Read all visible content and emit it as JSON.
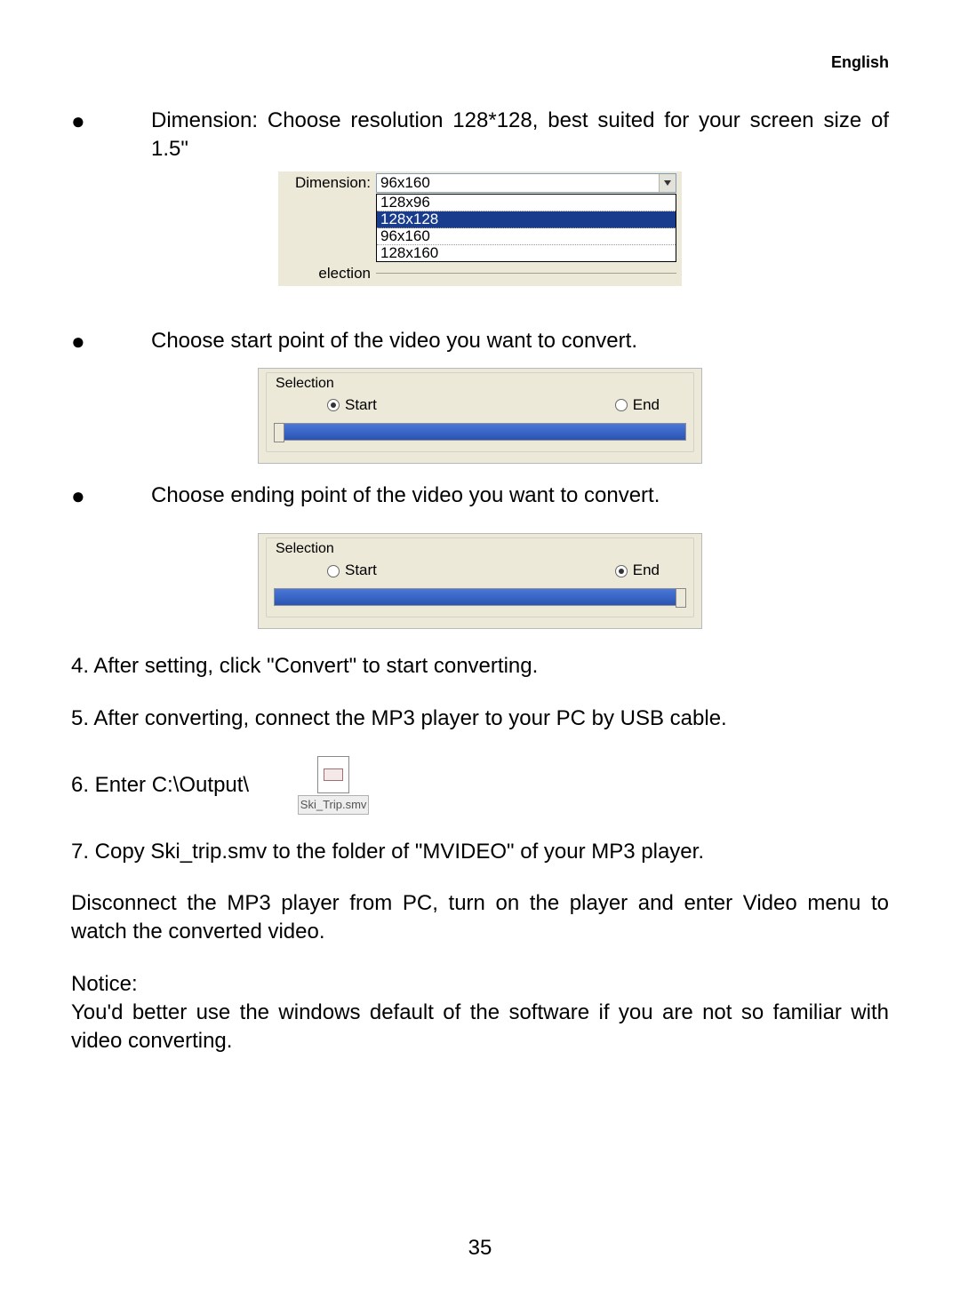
{
  "header": {
    "language": "English"
  },
  "bullets": {
    "b1": "Dimension: Choose resolution 128*128, best suited for your screen size of 1.5\"",
    "b2": "Choose start point of the video you want to convert.",
    "b3": "Choose ending point of the video you want to convert."
  },
  "dimension_ui": {
    "label": "Dimension:",
    "value": "96x160",
    "options": [
      "128x96",
      "128x128",
      "96x160",
      "128x160"
    ],
    "selected_index": 1,
    "bottom_label": "election"
  },
  "selection_ui": {
    "legend": "Selection",
    "start_label": "Start",
    "end_label": "End"
  },
  "steps": {
    "s4": "4. After setting, click \"Convert\" to start converting.",
    "s5": "5. After converting, connect the MP3 player to your PC by USB cable.",
    "s6": "6. Enter C:\\Output\\",
    "s7": "7. Copy Ski_trip.smv to the folder of \"MVIDEO\" of your MP3 player."
  },
  "file": {
    "name": "Ski_Trip.smv"
  },
  "paragraphs": {
    "disconnect": "Disconnect the MP3 player from PC, turn on the player and enter Video menu to watch the converted video.",
    "notice_label": "Notice:",
    "notice_body": "You'd better use the windows default of the software if you are not so familiar with video converting."
  },
  "page_number": "35"
}
